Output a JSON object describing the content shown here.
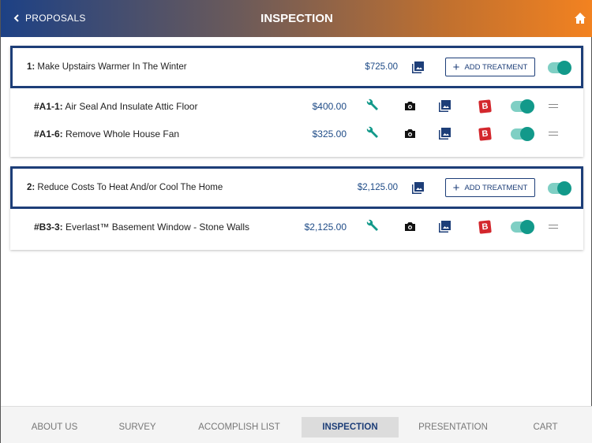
{
  "header": {
    "back_label": "PROPOSALS",
    "title": "INSPECTION"
  },
  "groups": [
    {
      "label_num": "1:",
      "label": " Make Upstairs Warmer In The Winter",
      "price": "$725.00",
      "add_label": "ADD TREATMENT",
      "enabled": true,
      "items": [
        {
          "code": "#A1-1:",
          "name": " Air Seal And Insulate Attic Floor",
          "price": "$400.00",
          "enabled": true
        },
        {
          "code": "#A1-6:",
          "name": " Remove Whole House Fan",
          "price": "$325.00",
          "enabled": true
        }
      ]
    },
    {
      "label_num": "2:",
      "label": " Reduce Costs To Heat And/or Cool The Home",
      "price": "$2,125.00",
      "add_label": "ADD TREATMENT",
      "enabled": true,
      "items": [
        {
          "code": "#B3-3:",
          "name": " Everlast™ Basement Window - Stone Walls",
          "price": "$2,125.00",
          "enabled": true
        }
      ]
    }
  ],
  "tabs": [
    "ABOUT US",
    "SURVEY",
    "ACCOMPLISH LIST",
    "INSPECTION",
    "PRESENTATION",
    "CART"
  ],
  "active_tab": "INSPECTION",
  "colors": {
    "navy": "#1d3e78",
    "teal": "#12998a",
    "orange": "#f38220",
    "red": "#d3272d"
  }
}
